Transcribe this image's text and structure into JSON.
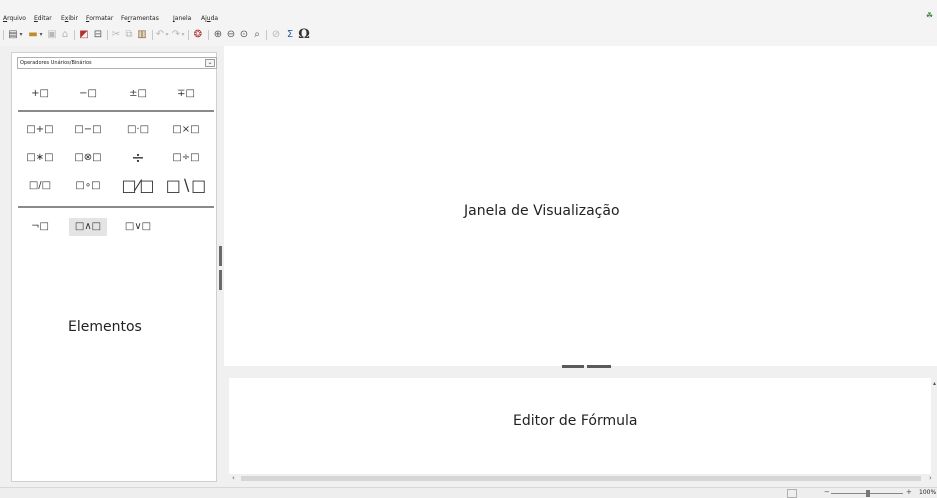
{
  "menubar": {
    "items": [
      {
        "accel": "A",
        "rest": "rquivo"
      },
      {
        "accel": "E",
        "rest": "ditar"
      },
      {
        "accel": "x",
        "pre": "E",
        "rest": "ibir"
      },
      {
        "accel": "F",
        "rest": "ormatar"
      },
      {
        "accel": "r",
        "pre": "Fe",
        "rest": "ramentas"
      },
      {
        "accel": "J",
        "rest": "anela"
      },
      {
        "accel": "u",
        "pre": "Aj",
        "rest": "da"
      }
    ]
  },
  "toolbar": {
    "omega": "Ω"
  },
  "elements_panel": {
    "category": "Operadores Unários/Binários",
    "unary": [
      "+□",
      "−□",
      "±□",
      "∓□"
    ],
    "binary_row1": [
      "□+□",
      "□−□",
      "□·□",
      "□×□"
    ],
    "binary_row2": [
      "□∗□",
      "□⊗□",
      "÷",
      "□÷□"
    ],
    "binary_row3": [
      "□/□",
      "□∘□",
      "□⁄□",
      "□∖□"
    ],
    "logic": [
      "¬□",
      "□∧□",
      "□∨□"
    ],
    "label": "Elementos"
  },
  "view": {
    "label": "Janela de Visualização"
  },
  "editor": {
    "label": "Editor de Fórmula"
  },
  "statusbar": {
    "zoom": "100%"
  }
}
